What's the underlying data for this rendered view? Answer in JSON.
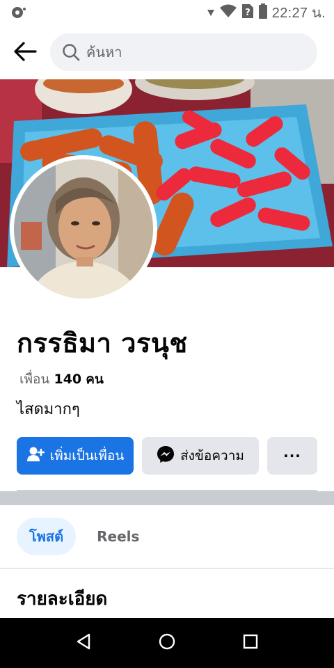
{
  "status_bar": {
    "time": "22:27 น.",
    "icons": [
      "assistant-icon",
      "signal-icon",
      "wifi-icon",
      "no-sim-icon",
      "battery-icon"
    ]
  },
  "search": {
    "placeholder": "ค้นหา"
  },
  "profile": {
    "name": "กรรธิมา วรนุช",
    "friends_label": "เพื่อน",
    "friends_count": "140",
    "friends_unit": "คน",
    "bio": "ไสดมากๆ"
  },
  "actions": {
    "add_friend": "เพิ่มเป็นเพื่อน",
    "message": "ส่งข้อความ",
    "more": "···"
  },
  "tabs": [
    {
      "label": "โพสต์",
      "active": true
    },
    {
      "label": "Reels",
      "active": false
    }
  ],
  "details": {
    "heading": "รายละเอียด"
  },
  "colors": {
    "accent": "#1b74e4",
    "button_bg": "#e4e6eb",
    "tab_active_bg": "#e7f3ff",
    "muted_text": "#65676b"
  },
  "icons": {
    "back": "arrow-left-icon",
    "search": "search-icon",
    "add_friend": "person-add-icon",
    "message": "messenger-icon",
    "nav": [
      "back-triangle-icon",
      "home-circle-icon",
      "recents-square-icon"
    ]
  }
}
